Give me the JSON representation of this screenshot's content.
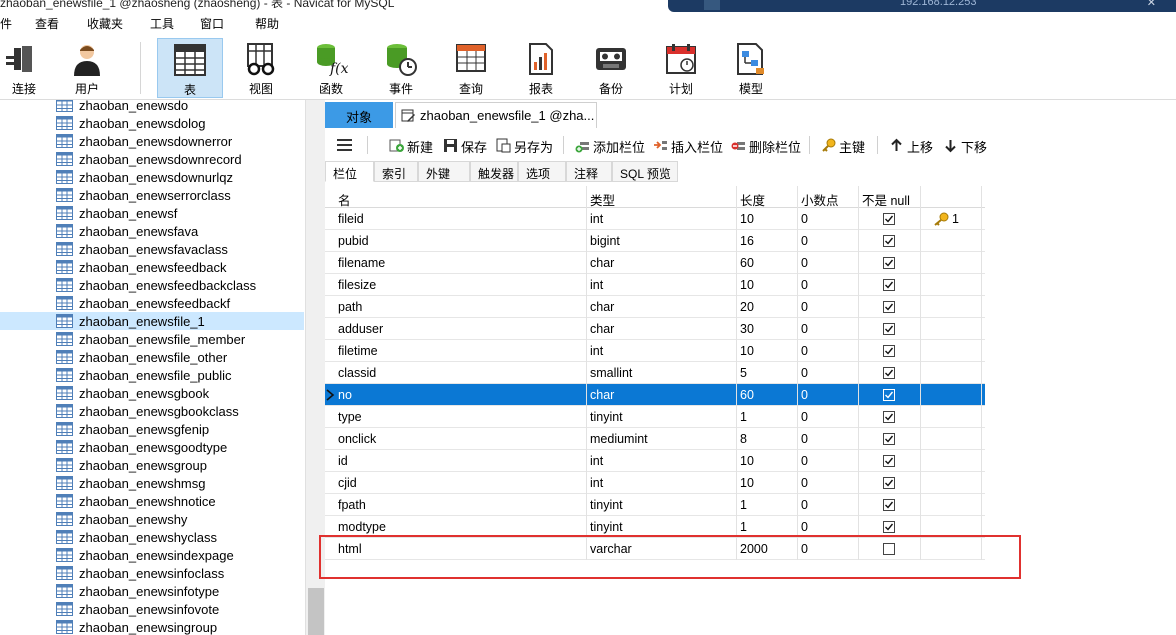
{
  "window": {
    "title": "zhaoban_enewsfile_1 @zhaosheng (zhaosheng) - 表 - Navicat for MySQL",
    "taskbar_ip": "192.168.12.253",
    "taskbar_close": "✕"
  },
  "menu": [
    "件",
    "查看",
    "收藏夹",
    "工具",
    "窗口",
    "帮助"
  ],
  "toolbar": [
    {
      "name": "connect",
      "label": "连接"
    },
    {
      "name": "user",
      "label": "用户"
    },
    {
      "name": "table",
      "label": "表",
      "active": true
    },
    {
      "name": "view",
      "label": "视图"
    },
    {
      "name": "function",
      "label": "函数"
    },
    {
      "name": "event",
      "label": "事件"
    },
    {
      "name": "query",
      "label": "查询"
    },
    {
      "name": "report",
      "label": "报表"
    },
    {
      "name": "backup",
      "label": "备份"
    },
    {
      "name": "schedule",
      "label": "计划"
    },
    {
      "name": "model",
      "label": "模型"
    }
  ],
  "tree": {
    "items": [
      "zhaoban_enewsdo",
      "zhaoban_enewsdolog",
      "zhaoban_enewsdownerror",
      "zhaoban_enewsdownrecord",
      "zhaoban_enewsdownurlqz",
      "zhaoban_enewserrorclass",
      "zhaoban_enewsf",
      "zhaoban_enewsfava",
      "zhaoban_enewsfavaclass",
      "zhaoban_enewsfeedback",
      "zhaoban_enewsfeedbackclass",
      "zhaoban_enewsfeedbackf",
      "zhaoban_enewsfile_1",
      "zhaoban_enewsfile_member",
      "zhaoban_enewsfile_other",
      "zhaoban_enewsfile_public",
      "zhaoban_enewsgbook",
      "zhaoban_enewsgbookclass",
      "zhaoban_enewsgfenip",
      "zhaoban_enewsgoodtype",
      "zhaoban_enewsgroup",
      "zhaoban_enewshmsg",
      "zhaoban_enewshnotice",
      "zhaoban_enewshy",
      "zhaoban_enewshyclass",
      "zhaoban_enewsindexpage",
      "zhaoban_enewsinfoclass",
      "zhaoban_enewsinfotype",
      "zhaoban_enewsinfovote",
      "zhaoban_enewsingroup"
    ],
    "selected": "zhaoban_enewsfile_1"
  },
  "doc_tabs": {
    "objects": "对象",
    "current": "zhaoban_enewsfile_1 @zha..."
  },
  "actions": {
    "new": "新建",
    "save": "保存",
    "save_as": "另存为",
    "add_field": "添加栏位",
    "insert_field": "插入栏位",
    "delete_field": "删除栏位",
    "primary_key": "主键",
    "move_up": "上移",
    "move_down": "下移"
  },
  "subtabs": [
    "栏位",
    "索引",
    "外键",
    "触发器",
    "选项",
    "注释",
    "SQL 预览"
  ],
  "grid": {
    "headers": {
      "name": "名",
      "type": "类型",
      "length": "长度",
      "decimals": "小数点",
      "not_null": "不是 null",
      "key": ""
    },
    "rows": [
      {
        "name": "fileid",
        "type": "int",
        "length": "10",
        "decimals": "0",
        "not_null": true,
        "key": "1"
      },
      {
        "name": "pubid",
        "type": "bigint",
        "length": "16",
        "decimals": "0",
        "not_null": true,
        "key": ""
      },
      {
        "name": "filename",
        "type": "char",
        "length": "60",
        "decimals": "0",
        "not_null": true,
        "key": ""
      },
      {
        "name": "filesize",
        "type": "int",
        "length": "10",
        "decimals": "0",
        "not_null": true,
        "key": ""
      },
      {
        "name": "path",
        "type": "char",
        "length": "20",
        "decimals": "0",
        "not_null": true,
        "key": ""
      },
      {
        "name": "adduser",
        "type": "char",
        "length": "30",
        "decimals": "0",
        "not_null": true,
        "key": ""
      },
      {
        "name": "filetime",
        "type": "int",
        "length": "10",
        "decimals": "0",
        "not_null": true,
        "key": ""
      },
      {
        "name": "classid",
        "type": "smallint",
        "length": "5",
        "decimals": "0",
        "not_null": true,
        "key": ""
      },
      {
        "name": "no",
        "type": "char",
        "length": "60",
        "decimals": "0",
        "not_null": true,
        "key": ""
      },
      {
        "name": "type",
        "type": "tinyint",
        "length": "1",
        "decimals": "0",
        "not_null": true,
        "key": ""
      },
      {
        "name": "onclick",
        "type": "mediumint",
        "length": "8",
        "decimals": "0",
        "not_null": true,
        "key": ""
      },
      {
        "name": "id",
        "type": "int",
        "length": "10",
        "decimals": "0",
        "not_null": true,
        "key": ""
      },
      {
        "name": "cjid",
        "type": "int",
        "length": "10",
        "decimals": "0",
        "not_null": true,
        "key": ""
      },
      {
        "name": "fpath",
        "type": "tinyint",
        "length": "1",
        "decimals": "0",
        "not_null": true,
        "key": ""
      },
      {
        "name": "modtype",
        "type": "tinyint",
        "length": "1",
        "decimals": "0",
        "not_null": true,
        "key": ""
      },
      {
        "name": "html",
        "type": "varchar",
        "length": "2000",
        "decimals": "0",
        "not_null": false,
        "key": ""
      }
    ],
    "selected_row": "no",
    "highlighted_row": "html",
    "highlight_color": "#e0312f",
    "selection_color": "#0b78d4"
  }
}
